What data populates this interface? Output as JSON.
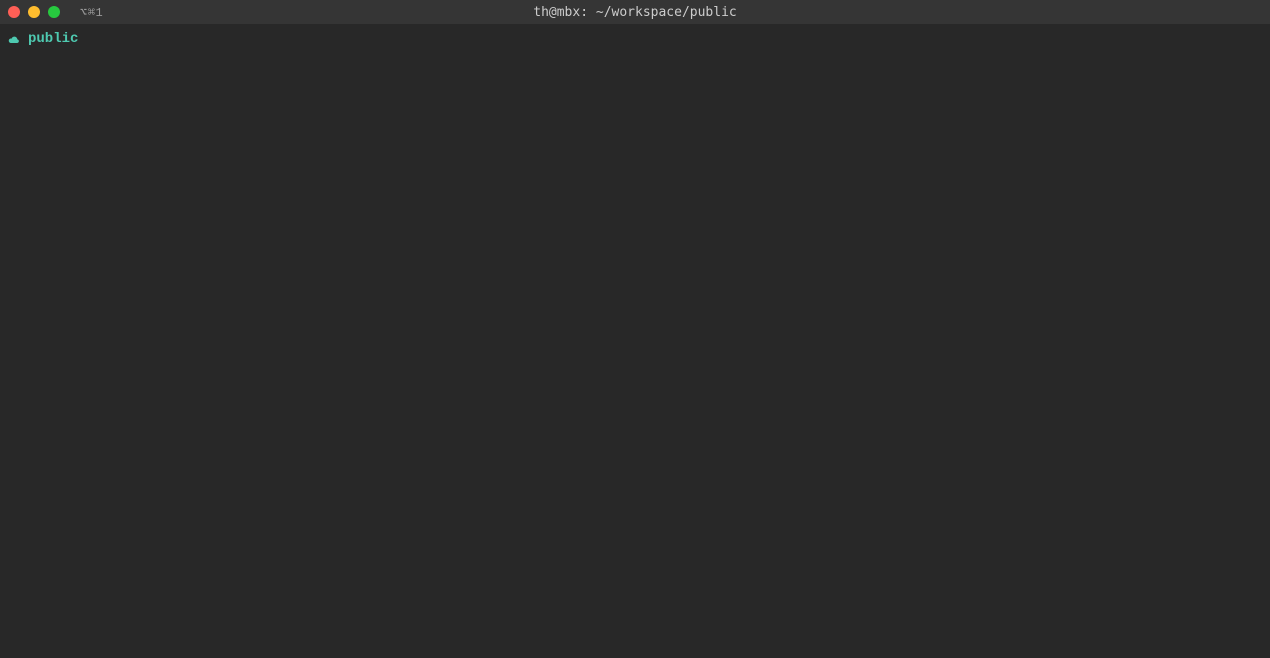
{
  "titlebar": {
    "title": "th@mbx: ~/workspace/public",
    "tab_indicator": "⌥⌘1"
  },
  "prompt": {
    "directory": "public",
    "command": ""
  },
  "colors": {
    "background": "#282828",
    "titlebar": "#353535",
    "prompt_accent": "#4ec9b0"
  }
}
